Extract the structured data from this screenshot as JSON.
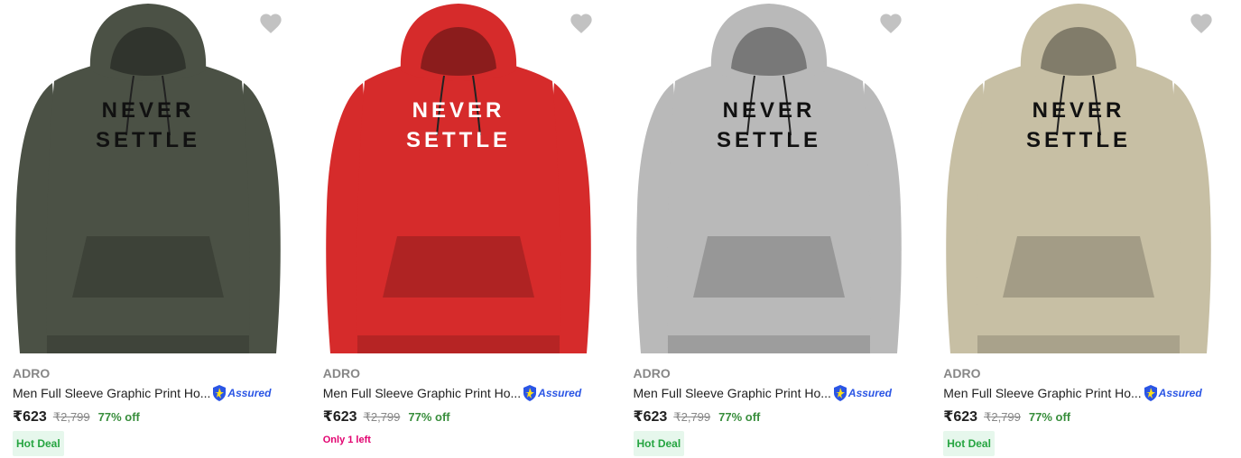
{
  "products": [
    {
      "brand": "ADRO",
      "title": "Men Full Sleeve Graphic Print Ho...",
      "assured_label": "Assured",
      "price": "₹623",
      "mrp": "₹2,799",
      "discount": "77% off",
      "tag": "Hot Deal",
      "tag_type": "hot",
      "print_line1": "NEVER",
      "print_line2": "SETTLE",
      "hoodie_color": "#4b5145",
      "print_color": "#111111",
      "wishlist_icon": "heart-icon"
    },
    {
      "brand": "ADRO",
      "title": "Men Full Sleeve Graphic Print Ho...",
      "assured_label": "Assured",
      "price": "₹623",
      "mrp": "₹2,799",
      "discount": "77% off",
      "tag": "Only 1 left",
      "tag_type": "stock",
      "print_line1": "NEVER",
      "print_line2": "SETTLE",
      "hoodie_color": "#d62b2b",
      "print_color": "#ffffff",
      "wishlist_icon": "heart-icon"
    },
    {
      "brand": "ADRO",
      "title": "Men Full Sleeve Graphic Print Ho...",
      "assured_label": "Assured",
      "price": "₹623",
      "mrp": "₹2,799",
      "discount": "77% off",
      "tag": "Hot Deal",
      "tag_type": "hot",
      "print_line1": "NEVER",
      "print_line2": "SETTLE",
      "hoodie_color": "#b9b9b9",
      "print_color": "#111111",
      "wishlist_icon": "heart-icon"
    },
    {
      "brand": "ADRO",
      "title": "Men Full Sleeve Graphic Print Ho...",
      "assured_label": "Assured",
      "price": "₹623",
      "mrp": "₹2,799",
      "discount": "77% off",
      "tag": "Hot Deal",
      "tag_type": "hot",
      "print_line1": "NEVER",
      "print_line2": "SETTLE",
      "hoodie_color": "#c7bfa4",
      "print_color": "#111111",
      "wishlist_icon": "heart-icon"
    }
  ],
  "colors": {
    "price_text": "#212121",
    "discount": "#388e3c",
    "hot_deal_bg": "#e6f7ec",
    "hot_deal_text": "#26a541",
    "stock_text": "#e2006f",
    "assured_blue": "#2a55e5",
    "wishlist_heart": "#c2c2c2"
  }
}
